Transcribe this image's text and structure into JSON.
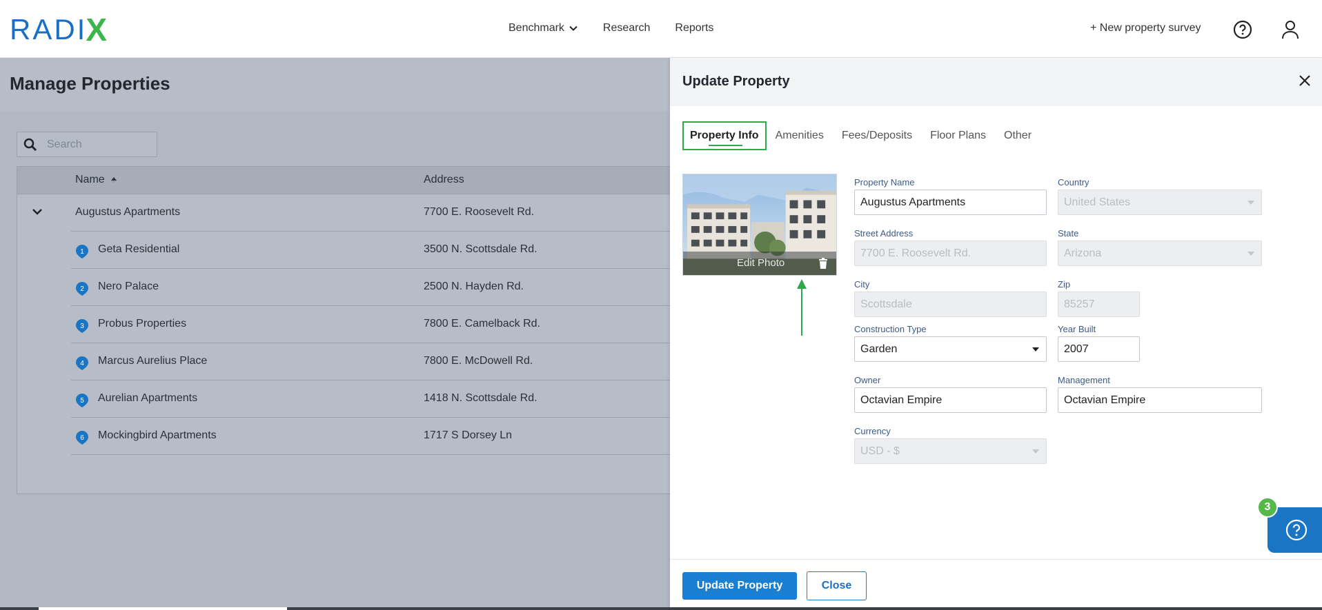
{
  "brand": {
    "logo_text": "RADI",
    "logo_x": "X"
  },
  "nav": {
    "benchmark": "Benchmark",
    "research": "Research",
    "reports": "Reports",
    "new_survey": "+ New property survey"
  },
  "manage": {
    "title": "Manage Properties",
    "search_placeholder": "Search",
    "columns": {
      "name": "Name",
      "address": "Address"
    },
    "rows": [
      {
        "name": "Augustus Apartments",
        "address": "7700 E. Roosevelt Rd."
      },
      {
        "num": "1",
        "name": "Geta Residential",
        "address": "3500 N. Scottsdale Rd."
      },
      {
        "num": "2",
        "name": "Nero Palace",
        "address": "2500 N. Hayden Rd."
      },
      {
        "num": "3",
        "name": "Probus Properties",
        "address": "7800 E. Camelback Rd."
      },
      {
        "num": "4",
        "name": "Marcus Aurelius Place",
        "address": "7800 E. McDowell Rd."
      },
      {
        "num": "5",
        "name": "Aurelian Apartments",
        "address": "1418 N. Scottsdale Rd."
      },
      {
        "num": "6",
        "name": "Mockingbird Apartments",
        "address": "1717 S Dorsey Ln"
      }
    ]
  },
  "drawer": {
    "title": "Update Property",
    "tabs": [
      "Property Info",
      "Amenities",
      "Fees/Deposits",
      "Floor Plans",
      "Other"
    ],
    "edit_photo": "Edit Photo",
    "fields": {
      "property_name": {
        "label": "Property Name",
        "value": "Augustus Apartments"
      },
      "country": {
        "label": "Country",
        "value": "United States"
      },
      "street": {
        "label": "Street Address",
        "value": "7700 E. Roosevelt Rd."
      },
      "state": {
        "label": "State",
        "value": "Arizona"
      },
      "city": {
        "label": "City",
        "value": "Scottsdale"
      },
      "zip": {
        "label": "Zip",
        "value": "85257"
      },
      "construction": {
        "label": "Construction Type",
        "value": "Garden"
      },
      "year_built": {
        "label": "Year Built",
        "value": "2007"
      },
      "owner": {
        "label": "Owner",
        "value": "Octavian Empire"
      },
      "management": {
        "label": "Management",
        "value": "Octavian Empire"
      },
      "currency": {
        "label": "Currency",
        "value": "USD - $"
      }
    },
    "update_button": "Update Property",
    "close_button": "Close"
  },
  "help": {
    "badge_count": "3"
  },
  "colors": {
    "primary": "#1a7fd1",
    "accent_green": "#2ea84a",
    "overlay": "#b7bdc7"
  }
}
